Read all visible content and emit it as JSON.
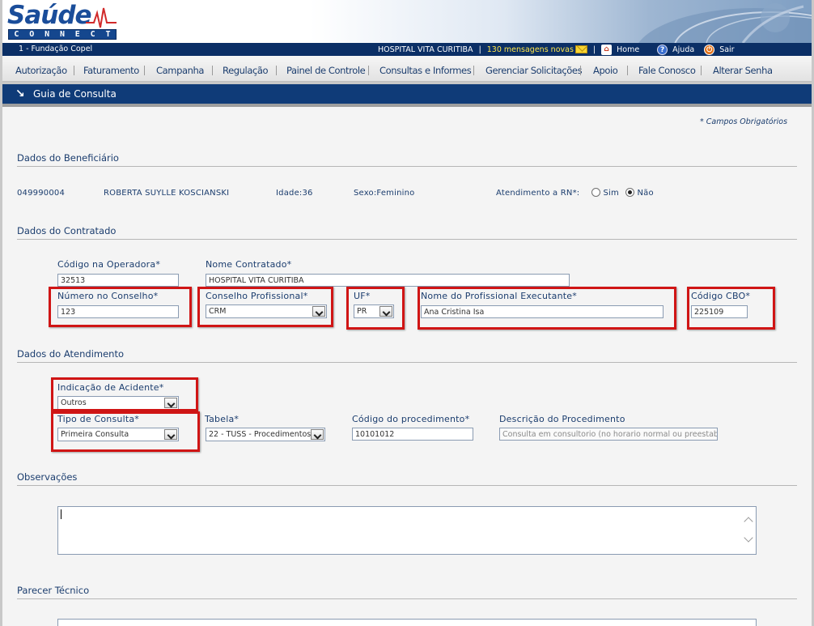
{
  "header": {
    "logo_word": "Saúde",
    "logo_sub": [
      "C",
      "O",
      "N",
      "N",
      "E",
      "C",
      "T"
    ]
  },
  "topbar": {
    "operator": "1 - Fundação Copel",
    "hospital": "HOSPITAL VITA CURITIBA",
    "messages": "130 mensagens novas",
    "home": "Home",
    "help": "Ajuda",
    "exit": "Sair"
  },
  "menu": {
    "items": [
      "Autorização",
      "Faturamento",
      "Campanha",
      "Regulação",
      "Painel de Controle",
      "Consultas e Informes",
      "Gerenciar Solicitações",
      "Apoio",
      "Fale Conosco",
      "Alterar Senha"
    ]
  },
  "page": {
    "title": "Guia de Consulta",
    "required_note": "* Campos Obrigatórios"
  },
  "beneficiario": {
    "section": "Dados do Beneficiário",
    "carteira": "049990004",
    "nome": "ROBERTA SUYLLE KOSCIANSKI",
    "idade": "Idade:36",
    "sexo": "Sexo:Feminino",
    "rn_label": "Atendimento a RN*:",
    "rn_sim": "Sim",
    "rn_nao": "Não",
    "rn_selected": "Não"
  },
  "contratado": {
    "section": "Dados do Contratado",
    "codigo_label": "Código na Operadora*",
    "codigo_value": "32513",
    "nome_label": "Nome Contratado*",
    "nome_value": "HOSPITAL VITA CURITIBA",
    "conselho_num_label": "Número no Conselho*",
    "conselho_num_value": "123",
    "conselho_label": "Conselho Profissional*",
    "conselho_value": "CRM",
    "uf_label": "UF*",
    "uf_value": "PR",
    "profissional_label": "Nome do Profissional Executante*",
    "profissional_value": "Ana Cristina Isa",
    "cbo_label": "Código CBO*",
    "cbo_value": "225109"
  },
  "atendimento": {
    "section": "Dados do Atendimento",
    "acidente_label": "Indicação de Acidente*",
    "acidente_value": "Outros",
    "tipo_label": "Tipo de Consulta*",
    "tipo_value": "Primeira Consulta",
    "tabela_label": "Tabela*",
    "tabela_value": "22 - TUSS - Procedimentos",
    "proc_label": "Código do procedimento*",
    "proc_value": "10101012",
    "desc_label": "Descrição do Procedimento",
    "desc_value": "Consulta em consultorio (no horario normal ou preestabelecido)"
  },
  "observacoes": {
    "section": "Observações",
    "value": ""
  },
  "parecer": {
    "section": "Parecer Técnico"
  },
  "colors": {
    "navy": "#0b2f66",
    "title_bar": "#0f3b78",
    "text": "#1b3d6e",
    "highlight": "#d01515",
    "messages": "#ffe64a"
  }
}
